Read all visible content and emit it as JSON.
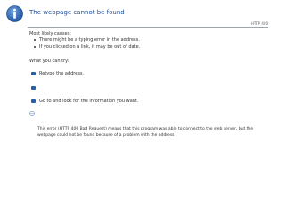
{
  "header": {
    "title": "The webpage cannot be found",
    "http_code": "HTTP 400",
    "icon": "info-icon",
    "accent_color": "#1f4f9b"
  },
  "causes": {
    "heading": "Most likely causes:",
    "items": [
      "There might be a typing error in the address.",
      "If you clicked on a link, it may be out of date."
    ]
  },
  "actions": {
    "heading": "What you can try:",
    "items": [
      {
        "icon": "arrow-icon",
        "label": "Retype the address."
      },
      {
        "icon": "arrow-icon",
        "label": ""
      },
      {
        "icon": "arrow-icon",
        "label": "Go to  and look for the information you want."
      }
    ],
    "more_icon": "expand-chevron-icon"
  },
  "details": {
    "text": "This error (HTTP 400 Bad Request) means that this program was able to connect to the web server, but the webpage could not be found because of a problem with the address."
  }
}
